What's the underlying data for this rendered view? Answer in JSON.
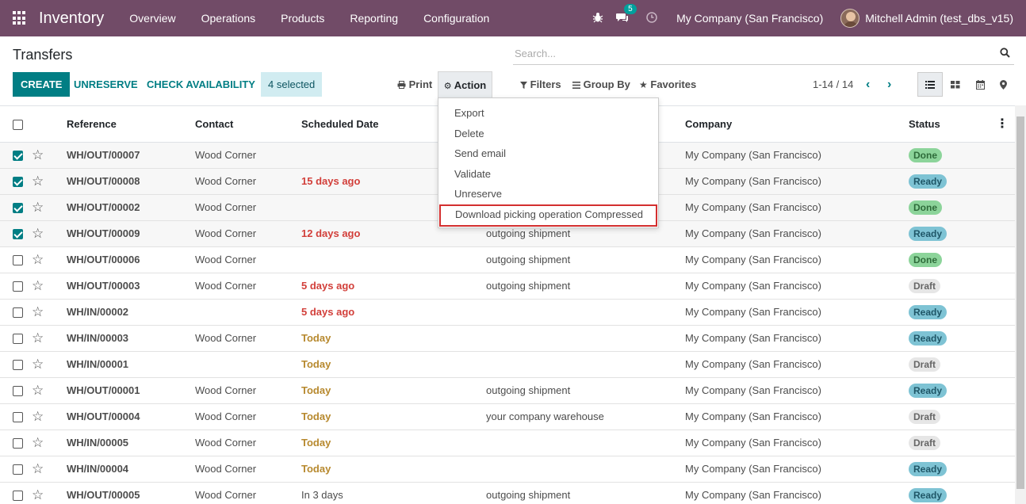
{
  "navbar": {
    "app_name": "Inventory",
    "menu": [
      "Overview",
      "Operations",
      "Products",
      "Reporting",
      "Configuration"
    ],
    "chat_count": "5",
    "company": "My Company (San Francisco)",
    "user": "Mitchell Admin (test_dbs_v15)",
    "bg_color": "#714b67"
  },
  "control": {
    "title": "Transfers",
    "search_placeholder": "Search...",
    "create_label": "CREATE",
    "unreserve_label": "UNRESERVE",
    "check_availability_label": "CHECK AVAILABILITY",
    "selected_label": "4 selected",
    "print_label": "Print",
    "action_label": "Action",
    "filters_label": "Filters",
    "group_by_label": "Group By",
    "favorites_label": "Favorites",
    "pager": "1-14 / 14",
    "accent_color": "#017e84"
  },
  "action_menu": {
    "items": [
      "Export",
      "Delete",
      "Send email",
      "Validate",
      "Unreserve",
      "Download picking operation Compressed"
    ]
  },
  "table": {
    "columns": [
      "Reference",
      "Contact",
      "Scheduled Date",
      "Company",
      "Status"
    ],
    "rows": [
      {
        "checked": true,
        "reference": "WH/OUT/00007",
        "contact": "Wood Corner",
        "date": "",
        "date_style": "normal",
        "source": "",
        "company": "My Company (San Francisco)",
        "status": "Done"
      },
      {
        "checked": true,
        "reference": "WH/OUT/00008",
        "contact": "Wood Corner",
        "date": "15 days ago",
        "date_style": "red",
        "source": "",
        "company": "My Company (San Francisco)",
        "status": "Ready"
      },
      {
        "checked": true,
        "reference": "WH/OUT/00002",
        "contact": "Wood Corner",
        "date": "",
        "date_style": "normal",
        "source": "",
        "company": "My Company (San Francisco)",
        "status": "Done"
      },
      {
        "checked": true,
        "reference": "WH/OUT/00009",
        "contact": "Wood Corner",
        "date": "12 days ago",
        "date_style": "red",
        "source": "outgoing shipment",
        "company": "My Company (San Francisco)",
        "status": "Ready"
      },
      {
        "checked": false,
        "reference": "WH/OUT/00006",
        "contact": "Wood Corner",
        "date": "",
        "date_style": "normal",
        "source": "outgoing shipment",
        "company": "My Company (San Francisco)",
        "status": "Done"
      },
      {
        "checked": false,
        "reference": "WH/OUT/00003",
        "contact": "Wood Corner",
        "date": "5 days ago",
        "date_style": "red",
        "source": "outgoing shipment",
        "company": "My Company (San Francisco)",
        "status": "Draft"
      },
      {
        "checked": false,
        "reference": "WH/IN/00002",
        "contact": "",
        "date": "5 days ago",
        "date_style": "red",
        "source": "",
        "company": "My Company (San Francisco)",
        "status": "Ready"
      },
      {
        "checked": false,
        "reference": "WH/IN/00003",
        "contact": "Wood Corner",
        "date": "Today",
        "date_style": "orange",
        "source": "",
        "company": "My Company (San Francisco)",
        "status": "Ready"
      },
      {
        "checked": false,
        "reference": "WH/IN/00001",
        "contact": "",
        "date": "Today",
        "date_style": "orange",
        "source": "",
        "company": "My Company (San Francisco)",
        "status": "Draft"
      },
      {
        "checked": false,
        "reference": "WH/OUT/00001",
        "contact": "Wood Corner",
        "date": "Today",
        "date_style": "orange",
        "source": "outgoing shipment",
        "company": "My Company (San Francisco)",
        "status": "Ready"
      },
      {
        "checked": false,
        "reference": "WH/OUT/00004",
        "contact": "Wood Corner",
        "date": "Today",
        "date_style": "orange",
        "source": "your company warehouse",
        "company": "My Company (San Francisco)",
        "status": "Draft"
      },
      {
        "checked": false,
        "reference": "WH/IN/00005",
        "contact": "Wood Corner",
        "date": "Today",
        "date_style": "orange",
        "source": "",
        "company": "My Company (San Francisco)",
        "status": "Draft"
      },
      {
        "checked": false,
        "reference": "WH/IN/00004",
        "contact": "Wood Corner",
        "date": "Today",
        "date_style": "orange",
        "source": "",
        "company": "My Company (San Francisco)",
        "status": "Ready"
      },
      {
        "checked": false,
        "reference": "WH/OUT/00005",
        "contact": "Wood Corner",
        "date": "In 3 days",
        "date_style": "normal",
        "source": "outgoing shipment",
        "company": "My Company (San Francisco)",
        "status": "Ready"
      }
    ]
  }
}
